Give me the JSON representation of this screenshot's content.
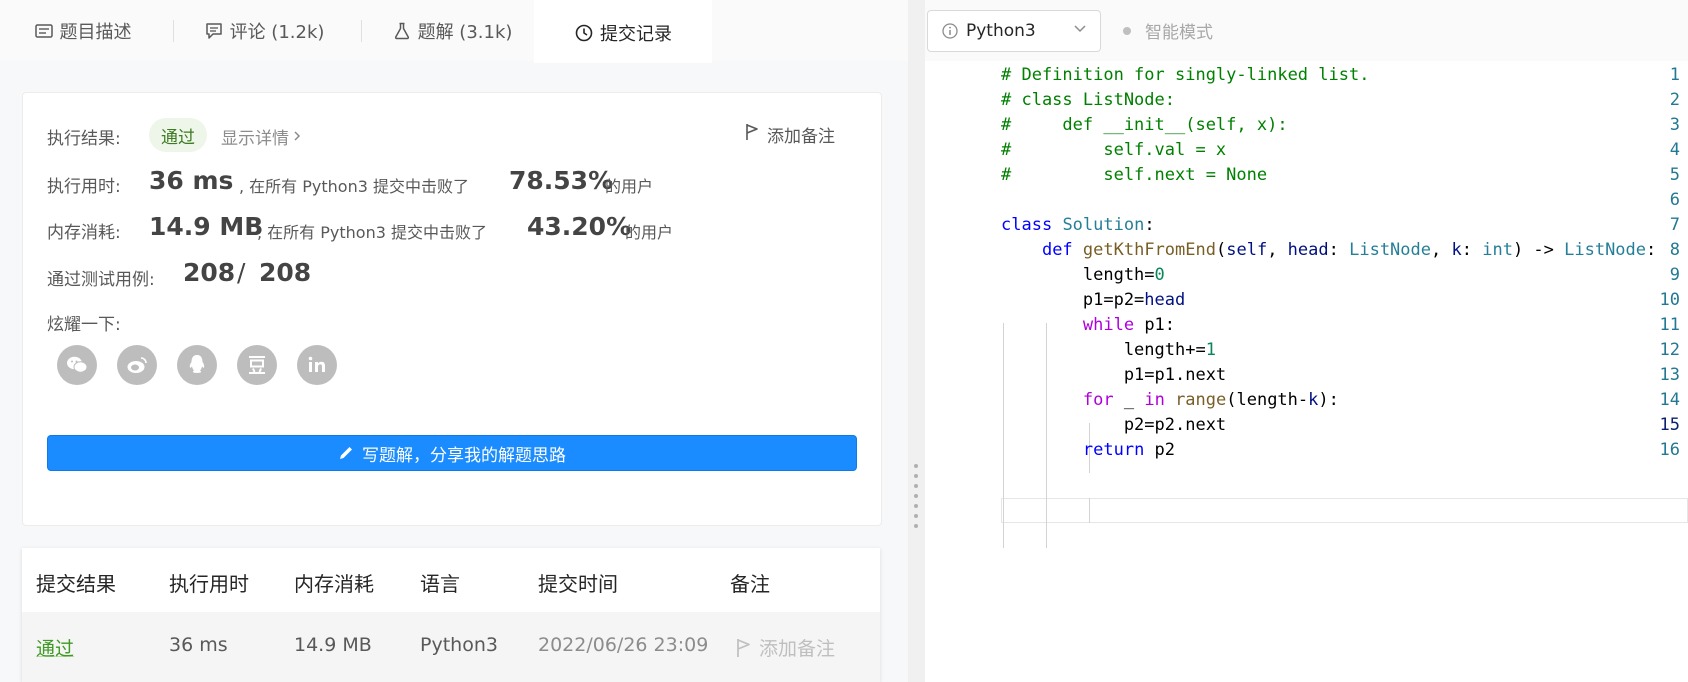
{
  "tabs": [
    {
      "label": "题目描述",
      "icon": "description-icon"
    },
    {
      "label": "评论 (1.2k)",
      "icon": "comment-icon"
    },
    {
      "label": "题解 (3.1k)",
      "icon": "flask-icon"
    },
    {
      "label": "提交记录",
      "icon": "clock-icon"
    }
  ],
  "result": {
    "exec_label": "执行结果:",
    "status": "通过",
    "details_link": "显示详情",
    "add_note": "添加备注",
    "time_label": "执行用时:",
    "time_value": "36 ms",
    "time_text": ", 在所有 Python3 提交中击败了",
    "time_pct": "78.53%",
    "time_suffix": "的用户",
    "mem_label": "内存消耗:",
    "mem_value": "14.9 MB",
    "mem_text": ", 在所有 Python3 提交中击败了",
    "mem_pct": "43.20%",
    "mem_suffix": "的用户",
    "cases_label": "通过测试用例:",
    "cases_passed": "208",
    "cases_sep": "/",
    "cases_total": "208",
    "share_label": "炫耀一下:",
    "social": [
      "wechat-icon",
      "weibo-icon",
      "qq-icon",
      "douban-icon",
      "linkedin-icon"
    ],
    "write_btn": "写题解，分享我的解题思路"
  },
  "table": {
    "headers": [
      "提交结果",
      "执行用时",
      "内存消耗",
      "语言",
      "提交时间",
      "备注"
    ],
    "row": {
      "status": "通过",
      "time": "36 ms",
      "memory": "14.9 MB",
      "lang": "Python3",
      "submitted": "2022/06/26 23:09",
      "note": "添加备注"
    }
  },
  "editor": {
    "language": "Python3",
    "smart_mode": "智能模式",
    "current_line": 15,
    "lines": [
      "# Definition for singly-linked list.",
      "# class ListNode:",
      "#     def __init__(self, x):",
      "#         self.val = x",
      "#         self.next = None",
      "",
      "class Solution:",
      "    def getKthFromEnd(self, head: ListNode, k: int) -> ListNode:",
      "        length=0",
      "        p1=p2=head",
      "        while p1:",
      "            length+=1",
      "            p1=p1.next",
      "        for _ in range(length-k):",
      "            p2=p2.next",
      "        return p2"
    ]
  },
  "colors": {
    "accent": "#1a8cff",
    "pass": "#3d7a22",
    "grey": "#8c8c8c"
  }
}
